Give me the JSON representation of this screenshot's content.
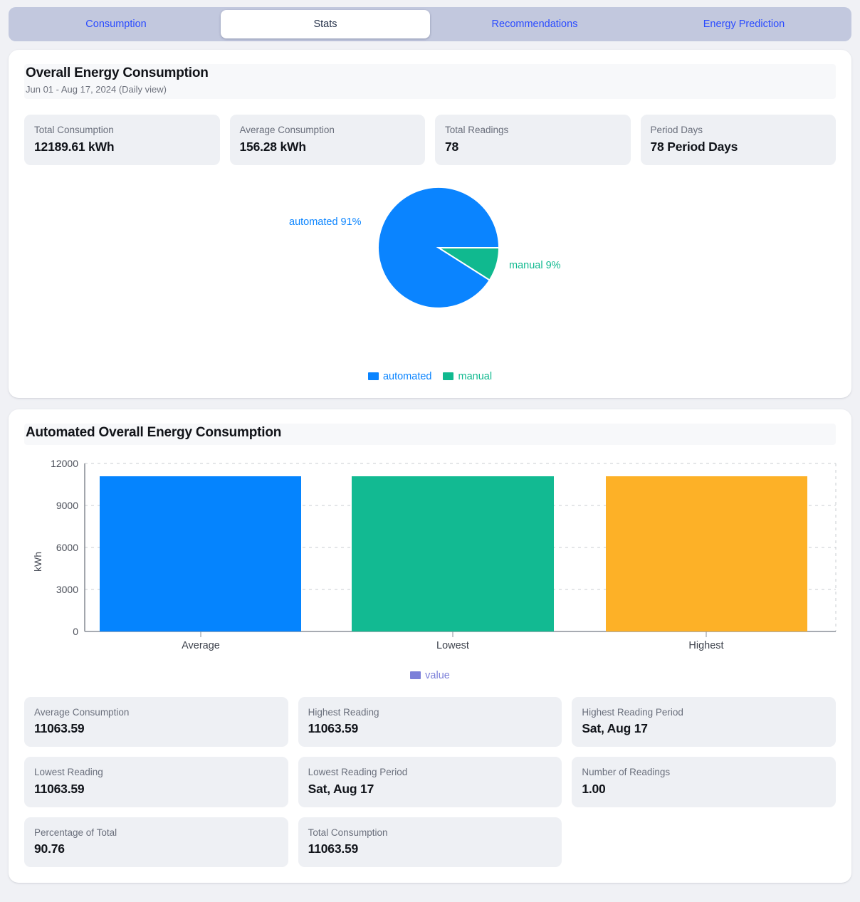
{
  "tabs": [
    {
      "label": "Consumption",
      "active": false
    },
    {
      "label": "Stats",
      "active": true
    },
    {
      "label": "Recommendations",
      "active": false
    },
    {
      "label": "Energy Prediction",
      "active": false
    }
  ],
  "overall": {
    "title": "Overall Energy Consumption",
    "subtitle": "Jun 01 - Aug 17, 2024 (Daily view)",
    "stats": [
      {
        "label": "Total Consumption",
        "value": "12189.61 kWh"
      },
      {
        "label": "Average Consumption",
        "value": "156.28 kWh"
      },
      {
        "label": "Total Readings",
        "value": "78"
      },
      {
        "label": "Period Days",
        "value": "78 Period Days"
      }
    ],
    "pie_labels": {
      "automated": "automated 91%",
      "manual": "manual 9%"
    },
    "legend": [
      {
        "label": "automated",
        "color": "#0a84ff"
      },
      {
        "label": "manual",
        "color": "#10b98f"
      }
    ]
  },
  "automated": {
    "title": "Automated Overall Energy Consumption",
    "legend": [
      {
        "label": "value",
        "color": "#7b7fd9"
      }
    ],
    "stats": [
      {
        "label": "Average Consumption",
        "value": "11063.59"
      },
      {
        "label": "Highest Reading",
        "value": "11063.59"
      },
      {
        "label": "Highest Reading Period",
        "value": "Sat, Aug 17"
      },
      {
        "label": "Lowest Reading",
        "value": "11063.59"
      },
      {
        "label": "Lowest Reading Period",
        "value": "Sat, Aug 17"
      },
      {
        "label": "Number of Readings",
        "value": "1.00"
      },
      {
        "label": "Percentage of Total",
        "value": "90.76"
      },
      {
        "label": "Total Consumption",
        "value": "11063.59"
      }
    ]
  },
  "chart_data": [
    {
      "type": "pie",
      "title": "Overall Energy Consumption",
      "labels": [
        "automated",
        "manual"
      ],
      "values": [
        91,
        9
      ],
      "value_unit": "%",
      "colors": [
        "#0a84ff",
        "#10b98f"
      ],
      "annotations": [
        "automated 91%",
        "manual 9%"
      ],
      "legend_position": "bottom"
    },
    {
      "type": "bar",
      "title": "Automated Overall Energy Consumption",
      "categories": [
        "Average",
        "Lowest",
        "Highest"
      ],
      "values": [
        11063.59,
        11063.59,
        11063.59
      ],
      "series": [
        {
          "name": "value",
          "values": [
            11063.59,
            11063.59,
            11063.59
          ]
        }
      ],
      "bar_colors": [
        "#0a84ff",
        "#10b98f",
        "#fdb127"
      ],
      "xlabel": "",
      "ylabel": "kWh",
      "ylim": [
        0,
        12000
      ],
      "yticks": [
        0,
        3000,
        6000,
        9000,
        12000
      ],
      "ytick_labels": [
        "0",
        "3000",
        "6000",
        "9000",
        "12000"
      ],
      "grid": true,
      "legend_position": "bottom",
      "legend_entries": [
        "value"
      ]
    }
  ]
}
